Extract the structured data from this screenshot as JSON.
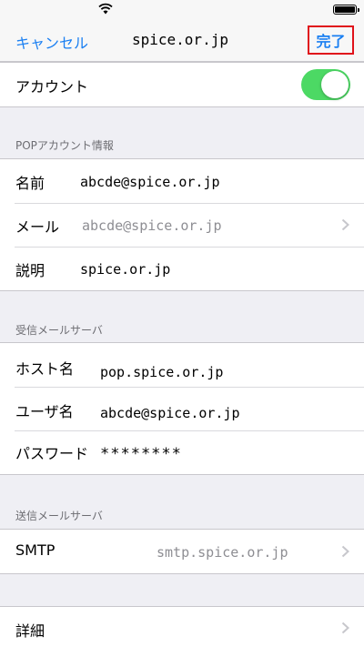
{
  "nav": {
    "cancel_label": "キャンセル",
    "title": "spice.or.jp",
    "done_label": "完了"
  },
  "account": {
    "label": "アカウント",
    "enabled": true
  },
  "pop_section": {
    "header": "POPアカウント情報",
    "rows": [
      {
        "label": "名前",
        "value": "abcde@spice.or.jp"
      },
      {
        "label": "メール",
        "value": "abcde@spice.or.jp"
      },
      {
        "label": "説明",
        "value": "spice.or.jp"
      }
    ]
  },
  "incoming_section": {
    "header": "受信メールサーバ",
    "rows": [
      {
        "label": "ホスト名",
        "value": "pop.spice.or.jp"
      },
      {
        "label": "ユーザ名",
        "value": "abcde@spice.or.jp"
      },
      {
        "label": "パスワード",
        "value": "********"
      }
    ]
  },
  "outgoing_section": {
    "header": "送信メールサーバ",
    "smtp_label": "SMTP",
    "smtp_value": "smtp.spice.or.jp"
  },
  "details": {
    "label": "詳細"
  },
  "colors": {
    "accent": "#1a7ff2",
    "toggle_on": "#4cd964",
    "highlight_border": "#e0121b"
  }
}
